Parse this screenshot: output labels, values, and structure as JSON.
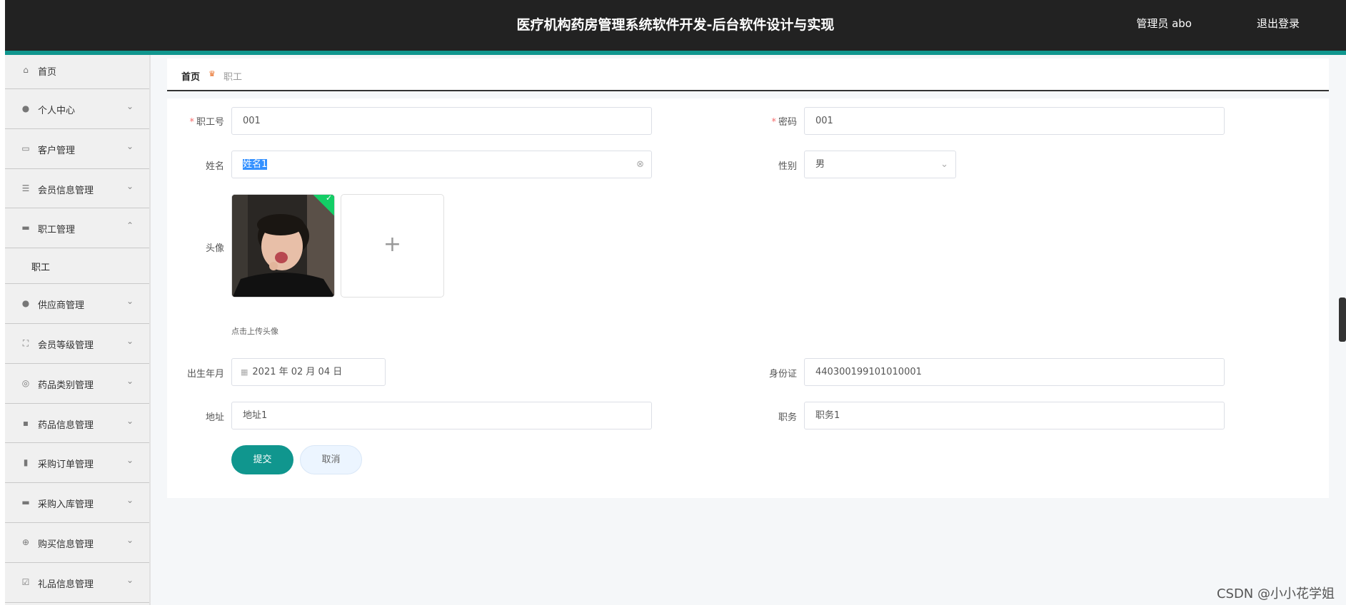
{
  "header": {
    "title": "医疗机构药房管理系统软件开发-后台软件设计与实现",
    "user": "管理员 abo",
    "logout": "退出登录"
  },
  "sidebar": {
    "items": [
      {
        "label": "首页",
        "icon": "home-icon"
      },
      {
        "label": "个人中心",
        "icon": "user-icon"
      },
      {
        "label": "客户管理",
        "icon": "chat-icon"
      },
      {
        "label": "会员信息管理",
        "icon": "list-icon"
      },
      {
        "label": "职工管理",
        "icon": "briefcase-icon",
        "expanded": true,
        "children": [
          "职工"
        ]
      },
      {
        "label": "供应商管理",
        "icon": "user-icon"
      },
      {
        "label": "会员等级管理",
        "icon": "fullscreen-icon"
      },
      {
        "label": "药品类别管理",
        "icon": "compass-icon"
      },
      {
        "label": "药品信息管理",
        "icon": "message-icon"
      },
      {
        "label": "采购订单管理",
        "icon": "clipboard-icon"
      },
      {
        "label": "采购入库管理",
        "icon": "box-icon"
      },
      {
        "label": "购买信息管理",
        "icon": "globe-icon"
      },
      {
        "label": "礼品信息管理",
        "icon": "checklist-icon"
      }
    ]
  },
  "breadcrumb": {
    "home": "首页",
    "current": "职工"
  },
  "form": {
    "employee_no": {
      "label": "职工号",
      "value": "001"
    },
    "password": {
      "label": "密码",
      "value": "001"
    },
    "name": {
      "label": "姓名",
      "value": "姓名1"
    },
    "gender": {
      "label": "性别",
      "value": "男"
    },
    "avatar": {
      "label": "头像",
      "upload_tip": "点击上传头像"
    },
    "birth": {
      "label": "出生年月",
      "value": "2021 年 02 月 04 日"
    },
    "id_card": {
      "label": "身份证",
      "value": "440300199101010001"
    },
    "address": {
      "label": "地址",
      "value": "地址1"
    },
    "position": {
      "label": "职务",
      "value": "职务1"
    },
    "submit": "提交",
    "cancel": "取消"
  },
  "watermark": "CSDN @小小花学姐"
}
